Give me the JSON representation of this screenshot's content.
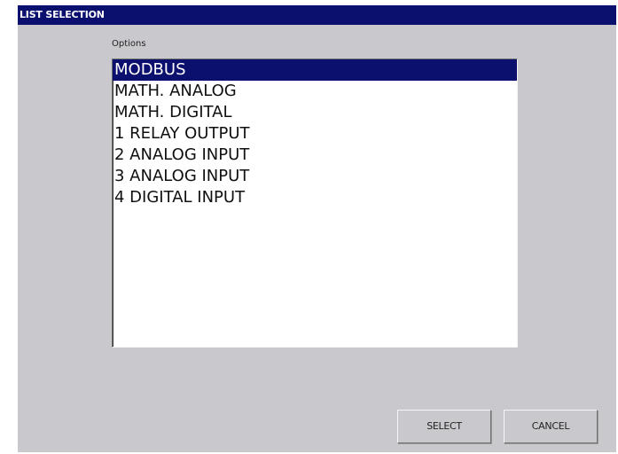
{
  "window": {
    "title": "LIST SELECTION"
  },
  "options_label": "Options",
  "list": {
    "selected_index": 0,
    "items": [
      "MODBUS",
      "MATH. ANALOG",
      "MATH. DIGITAL",
      "1 RELAY OUTPUT",
      "2 ANALOG INPUT",
      "3 ANALOG INPUT",
      "4 DIGITAL INPUT"
    ]
  },
  "buttons": {
    "select_label": "SELECT",
    "cancel_label": "CANCEL"
  },
  "colors": {
    "titlebar": "#0b0f6e",
    "selection": "#0b0f6e",
    "window_bg": "#c9c8cc"
  }
}
